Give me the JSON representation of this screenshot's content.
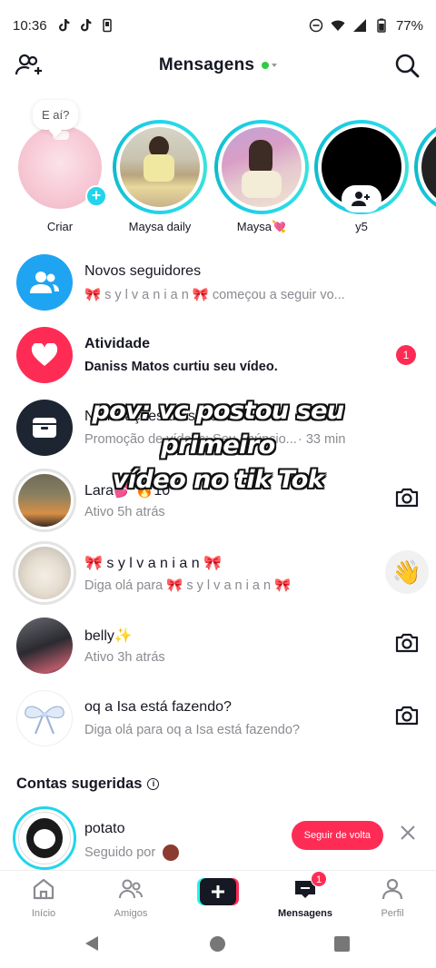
{
  "status_bar": {
    "time": "10:36",
    "battery": "77%"
  },
  "header": {
    "title": "Mensagens"
  },
  "stories": [
    {
      "label": "Criar",
      "bubble": "E aí?"
    },
    {
      "label": "Maysa daily"
    },
    {
      "label": "Maysa💘"
    },
    {
      "label": "y5"
    }
  ],
  "rows": [
    {
      "name": "Novos seguidores",
      "sub": "🎀 s y l v a n i a n 🎀 começou a seguir vo..."
    },
    {
      "name": "Atividade",
      "sub": "Daniss Matos curtiu seu vídeo.",
      "badge": "1"
    },
    {
      "name": "Notificações do sistema",
      "sub": "Promoção de vídeos: Seu anúncio...",
      "time": "· 33 min"
    },
    {
      "name": "Lara💕 🔥10",
      "sub": "Ativo 5h atrás"
    },
    {
      "name": "🎀 s y l v a n i a n 🎀",
      "sub": "Diga olá para 🎀 s y l v a n i a n 🎀"
    },
    {
      "name": "belly✨",
      "sub": "Ativo 3h atrás"
    },
    {
      "name": "oq a Isa está fazendo?",
      "sub": "Diga olá para oq a Isa está fazendo?"
    }
  ],
  "overlay": {
    "line1": "pov: vc postou seu primeiro",
    "line2": "vídeo no tik Tok"
  },
  "suggested": {
    "title": "Contas sugeridas",
    "name": "potato",
    "sub": "Seguido por",
    "button": "Seguir de volta"
  },
  "tabs": [
    {
      "label": "Início"
    },
    {
      "label": "Amigos"
    },
    {
      "label": "Mensagens",
      "badge": "1"
    },
    {
      "label": "Perfil"
    }
  ]
}
